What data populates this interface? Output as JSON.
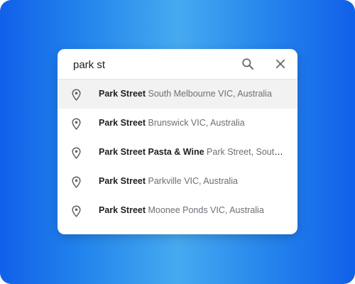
{
  "search": {
    "value": "park st",
    "placeholder": ""
  },
  "icons": {
    "search": "search-icon",
    "clear": "close-icon",
    "place": "map-pin-icon"
  },
  "colors": {
    "background_left": "#1160e9",
    "background_center": "#46aaf0",
    "card": "#ffffff",
    "highlight": "#f2f2f2",
    "primary_text": "#202124",
    "secondary_text": "#6b6f75",
    "icon": "#5f6368"
  },
  "suggestions": [
    {
      "primary": "Park Street",
      "secondary": "South Melbourne VIC, Australia",
      "highlighted": true
    },
    {
      "primary": "Park Street",
      "secondary": "Brunswick VIC, Australia",
      "highlighted": false
    },
    {
      "primary": "Park Street Pasta & Wine",
      "secondary": "Park Street, South Melbourne VIC, Australia",
      "highlighted": false
    },
    {
      "primary": "Park Street",
      "secondary": "Parkville VIC, Australia",
      "highlighted": false
    },
    {
      "primary": "Park Street",
      "secondary": "Moonee Ponds VIC, Australia",
      "highlighted": false
    }
  ]
}
